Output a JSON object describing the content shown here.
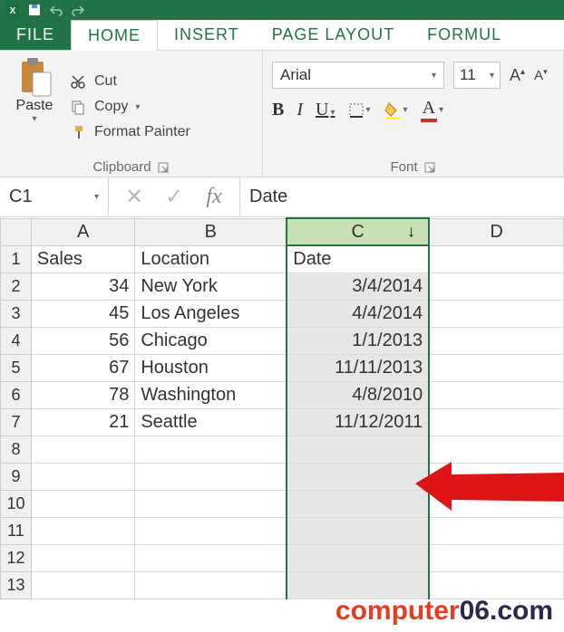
{
  "tabs": {
    "file": "FILE",
    "home": "HOME",
    "insert": "INSERT",
    "page_layout": "PAGE LAYOUT",
    "formulas": "FORMUL"
  },
  "clipboard": {
    "paste": "Paste",
    "cut": "Cut",
    "copy": "Copy",
    "format_painter": "Format Painter",
    "group_label": "Clipboard"
  },
  "font": {
    "name": "Arial",
    "size": "11",
    "bold": "B",
    "italic": "I",
    "underline": "U",
    "font_color_letter": "A",
    "increase_a": "A",
    "decrease_a": "A",
    "group_label": "Font"
  },
  "formula_bar": {
    "namebox": "C1",
    "cancel": "✕",
    "enter": "✓",
    "fx": "fx",
    "value": "Date"
  },
  "columns": [
    "A",
    "B",
    "C",
    "D"
  ],
  "rows": [
    "1",
    "2",
    "3",
    "4",
    "5",
    "6",
    "7",
    "8",
    "9",
    "10",
    "11",
    "12",
    "13"
  ],
  "data": {
    "A": [
      "Sales",
      "34",
      "45",
      "56",
      "67",
      "78",
      "21",
      "",
      "",
      "",
      "",
      "",
      ""
    ],
    "B": [
      "Location",
      "New York",
      "Los Angeles",
      "Chicago",
      "Houston",
      "Washington",
      "Seattle",
      "",
      "",
      "",
      "",
      "",
      ""
    ],
    "C": [
      "Date",
      "3/4/2014",
      "4/4/2014",
      "1/1/2013",
      "11/11/2013",
      "4/8/2010",
      "11/12/2011",
      "",
      "",
      "",
      "",
      "",
      ""
    ],
    "D": [
      "",
      "",
      "",
      "",
      "",
      "",
      "",
      "",
      "",
      "",
      "",
      "",
      ""
    ]
  },
  "watermark": {
    "part1": "computer",
    "part2": "06.com"
  }
}
